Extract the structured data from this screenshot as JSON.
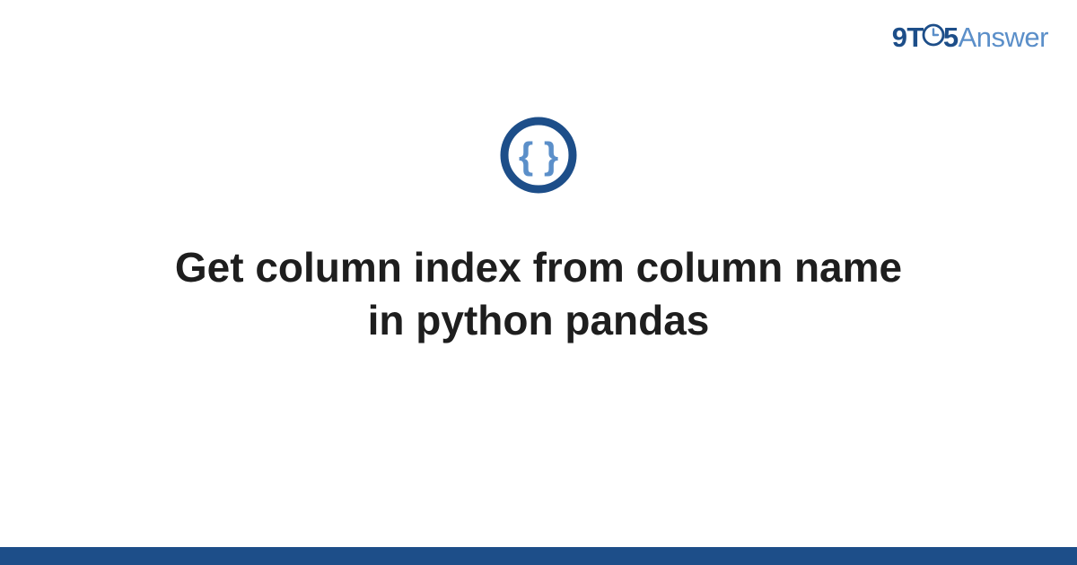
{
  "logo": {
    "part1": "9T",
    "part2": "5",
    "part3": "Answer"
  },
  "title": "Get column index from column name in python pandas",
  "colors": {
    "dark_blue": "#1d4e89",
    "light_blue": "#5b8fc9",
    "title_color": "#1e1e1e"
  }
}
